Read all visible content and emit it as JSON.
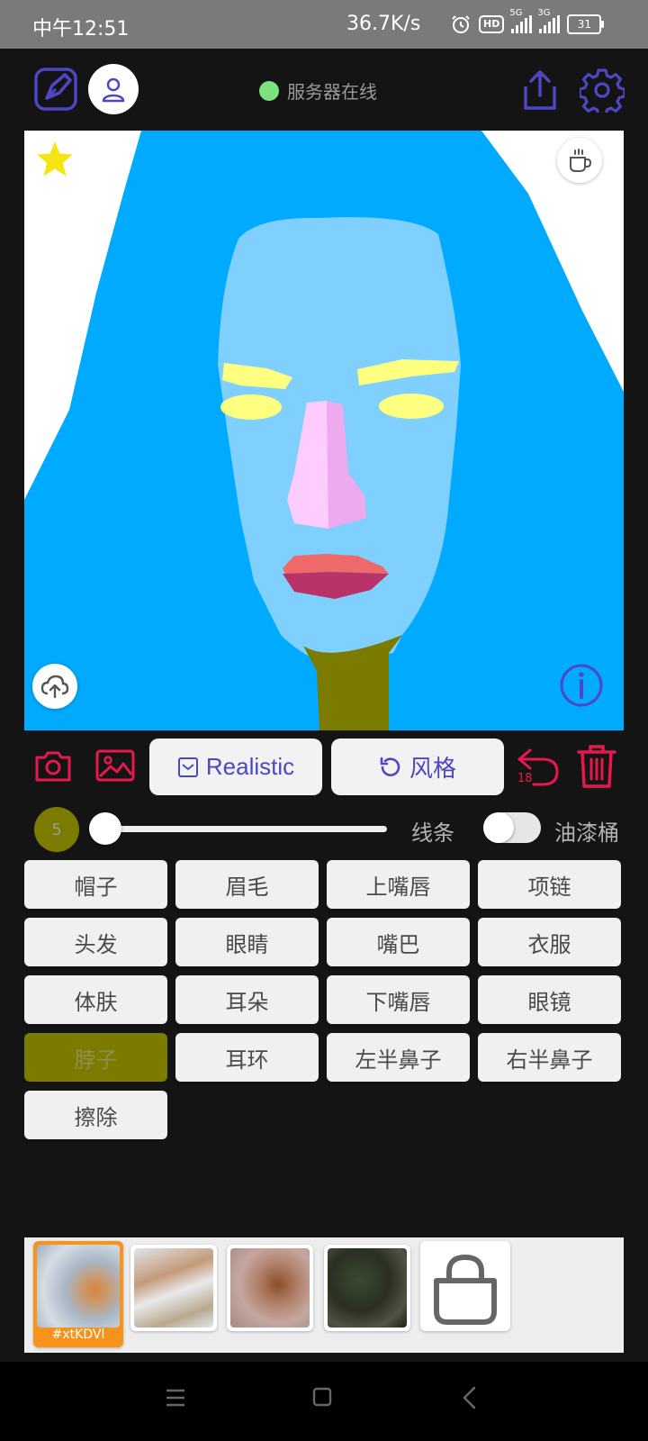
{
  "status_bar": {
    "time": "中午12:51",
    "speed": "36.7K/s",
    "hd_label": "HD",
    "signal1_label": "5G",
    "signal2_label": "3G",
    "battery": "31"
  },
  "header": {
    "server_status": "服务器在线",
    "status_color": "#7be27e"
  },
  "canvas": {
    "colors": {
      "hair": "#00aaff",
      "skin": "#80d0ff",
      "eyebrow": "#ffff80",
      "eye": "#ffff80",
      "nose_left": "#ffccff",
      "nose_right": "#eeaaee",
      "upper_lip": "#ee6a6a",
      "lower_lip": "#b8336a",
      "neck": "#7b7b00"
    }
  },
  "tools": {
    "realistic_label": "Realistic",
    "style_label": "风格",
    "undo_count": "18"
  },
  "brush": {
    "size": "5",
    "line_label": "线条",
    "bucket_label": "油漆桶",
    "slider_value": 0
  },
  "parts": [
    "帽子",
    "眉毛",
    "上嘴唇",
    "项链",
    "头发",
    "眼睛",
    "嘴巴",
    "衣服",
    "体肤",
    "耳朵",
    "下嘴唇",
    "眼镜",
    "脖子",
    "耳环",
    "左半鼻子",
    "右半鼻子",
    "擦除"
  ],
  "active_part": "脖子",
  "gallery": {
    "selected_label": "#xtKDVl"
  },
  "accent_colors": {
    "purple": "#4e47c5",
    "red": "#e8174d"
  }
}
